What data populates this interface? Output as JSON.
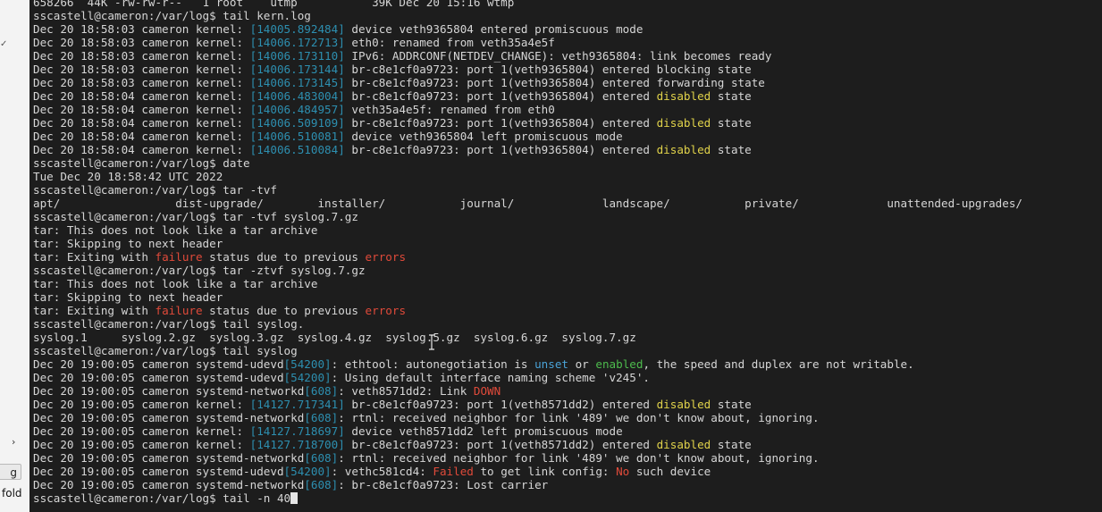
{
  "left_panel": {
    "chevron": "›",
    "button_text": "g",
    "fold_text": "fold"
  },
  "terminal": {
    "lines": [
      [
        {
          "t": "658266  44K -rw-rw-r--   1 root    utmp           39K Dec 20 15:16 wtmp"
        }
      ],
      [
        {
          "t": "sscastell@cameron:/var/log$ tail kern.log"
        }
      ],
      [
        {
          "t": "Dec 20 18:58:03 cameron kernel: "
        },
        {
          "t": "[14005.892484]",
          "c": "ts"
        },
        {
          "t": " device veth9365804 entered promiscuous mode"
        }
      ],
      [
        {
          "t": "Dec 20 18:58:03 cameron kernel: "
        },
        {
          "t": "[14006.172713]",
          "c": "ts"
        },
        {
          "t": " eth0: renamed from veth35a4e5f"
        }
      ],
      [
        {
          "t": "Dec 20 18:58:03 cameron kernel: "
        },
        {
          "t": "[14006.173110]",
          "c": "ts"
        },
        {
          "t": " IPv6: ADDRCONF(NETDEV_CHANGE): veth9365804: link becomes ready"
        }
      ],
      [
        {
          "t": "Dec 20 18:58:03 cameron kernel: "
        },
        {
          "t": "[14006.173144]",
          "c": "ts"
        },
        {
          "t": " br-c8e1cf0a9723: port 1(veth9365804) entered blocking state"
        }
      ],
      [
        {
          "t": "Dec 20 18:58:03 cameron kernel: "
        },
        {
          "t": "[14006.173145]",
          "c": "ts"
        },
        {
          "t": " br-c8e1cf0a9723: port 1(veth9365804) entered forwarding state"
        }
      ],
      [
        {
          "t": "Dec 20 18:58:04 cameron kernel: "
        },
        {
          "t": "[14006.483004]",
          "c": "ts"
        },
        {
          "t": " br-c8e1cf0a9723: port 1(veth9365804) entered "
        },
        {
          "t": "disabled",
          "c": "yl"
        },
        {
          "t": " state"
        }
      ],
      [
        {
          "t": "Dec 20 18:58:04 cameron kernel: "
        },
        {
          "t": "[14006.484957]",
          "c": "ts"
        },
        {
          "t": " veth35a4e5f: renamed from eth0"
        }
      ],
      [
        {
          "t": "Dec 20 18:58:04 cameron kernel: "
        },
        {
          "t": "[14006.509109]",
          "c": "ts"
        },
        {
          "t": " br-c8e1cf0a9723: port 1(veth9365804) entered "
        },
        {
          "t": "disabled",
          "c": "yl"
        },
        {
          "t": " state"
        }
      ],
      [
        {
          "t": "Dec 20 18:58:04 cameron kernel: "
        },
        {
          "t": "[14006.510081]",
          "c": "ts"
        },
        {
          "t": " device veth9365804 left promiscuous mode"
        }
      ],
      [
        {
          "t": "Dec 20 18:58:04 cameron kernel: "
        },
        {
          "t": "[14006.510084]",
          "c": "ts"
        },
        {
          "t": " br-c8e1cf0a9723: port 1(veth9365804) entered "
        },
        {
          "t": "disabled",
          "c": "yl"
        },
        {
          "t": " state"
        }
      ],
      [
        {
          "t": "sscastell@cameron:/var/log$ date"
        }
      ],
      [
        {
          "t": "Tue Dec 20 18:58:42 UTC 2022"
        }
      ],
      [
        {
          "t": "sscastell@cameron:/var/log$ tar -tvf"
        }
      ],
      [
        {
          "t": "apt/                 dist-upgrade/        installer/           journal/             landscape/           private/             unattended-upgrades/"
        }
      ],
      [
        {
          "t": "sscastell@cameron:/var/log$ tar -tvf syslog.7.gz"
        }
      ],
      [
        {
          "t": "tar: This does not look like a tar archive"
        }
      ],
      [
        {
          "t": "tar: Skipping to next header"
        }
      ],
      [
        {
          "t": "tar: Exiting with "
        },
        {
          "t": "failure",
          "c": "rd"
        },
        {
          "t": " status due to previous "
        },
        {
          "t": "errors",
          "c": "rd"
        }
      ],
      [
        {
          "t": "sscastell@cameron:/var/log$ tar -ztvf syslog.7.gz"
        }
      ],
      [
        {
          "t": "tar: This does not look like a tar archive"
        }
      ],
      [
        {
          "t": "tar: Skipping to next header"
        }
      ],
      [
        {
          "t": "tar: Exiting with "
        },
        {
          "t": "failure",
          "c": "rd"
        },
        {
          "t": " status due to previous "
        },
        {
          "t": "errors",
          "c": "rd"
        }
      ],
      [
        {
          "t": "sscastell@cameron:/var/log$ tail syslog."
        }
      ],
      [
        {
          "t": "syslog.1     syslog.2.gz  syslog.3.gz  syslog.4.gz  syslog.5.gz  syslog.6.gz  syslog.7.gz"
        }
      ],
      [
        {
          "t": "sscastell@cameron:/var/log$ tail syslog"
        }
      ],
      [
        {
          "t": "Dec 20 19:00:05 cameron systemd-udevd"
        },
        {
          "t": "[54200]",
          "c": "ts"
        },
        {
          "t": ": ethtool: autonegotiation is "
        },
        {
          "t": "unset",
          "c": "bl"
        },
        {
          "t": " or "
        },
        {
          "t": "enabled",
          "c": "gr"
        },
        {
          "t": ", the speed and duplex are not writable."
        }
      ],
      [
        {
          "t": "Dec 20 19:00:05 cameron systemd-udevd"
        },
        {
          "t": "[54200]",
          "c": "ts"
        },
        {
          "t": ": Using default interface naming scheme 'v245'."
        }
      ],
      [
        {
          "t": "Dec 20 19:00:05 cameron systemd-networkd"
        },
        {
          "t": "[608]",
          "c": "ts"
        },
        {
          "t": ": veth8571dd2: Link "
        },
        {
          "t": "DOWN",
          "c": "rd"
        }
      ],
      [
        {
          "t": "Dec 20 19:00:05 cameron kernel: "
        },
        {
          "t": "[14127.717341]",
          "c": "ts"
        },
        {
          "t": " br-c8e1cf0a9723: port 1(veth8571dd2) entered "
        },
        {
          "t": "disabled",
          "c": "yl"
        },
        {
          "t": " state"
        }
      ],
      [
        {
          "t": "Dec 20 19:00:05 cameron systemd-networkd"
        },
        {
          "t": "[608]",
          "c": "ts"
        },
        {
          "t": ": rtnl: received neighbor for link '489' we don't know about, ignoring."
        }
      ],
      [
        {
          "t": "Dec 20 19:00:05 cameron kernel: "
        },
        {
          "t": "[14127.718697]",
          "c": "ts"
        },
        {
          "t": " device veth8571dd2 left promiscuous mode"
        }
      ],
      [
        {
          "t": "Dec 20 19:00:05 cameron kernel: "
        },
        {
          "t": "[14127.718700]",
          "c": "ts"
        },
        {
          "t": " br-c8e1cf0a9723: port 1(veth8571dd2) entered "
        },
        {
          "t": "disabled",
          "c": "yl"
        },
        {
          "t": " state"
        }
      ],
      [
        {
          "t": "Dec 20 19:00:05 cameron systemd-networkd"
        },
        {
          "t": "[608]",
          "c": "ts"
        },
        {
          "t": ": rtnl: received neighbor for link '489' we don't know about, ignoring."
        }
      ],
      [
        {
          "t": "Dec 20 19:00:05 cameron systemd-udevd"
        },
        {
          "t": "[54200]",
          "c": "ts"
        },
        {
          "t": ": vethc581cd4: "
        },
        {
          "t": "Failed",
          "c": "rd"
        },
        {
          "t": " to get link config: "
        },
        {
          "t": "No",
          "c": "rd"
        },
        {
          "t": " such device"
        }
      ],
      [
        {
          "t": "Dec 20 19:00:05 cameron systemd-networkd"
        },
        {
          "t": "[608]",
          "c": "ts"
        },
        {
          "t": ": br-c8e1cf0a9723: Lost carrier"
        }
      ],
      [
        {
          "t": "sscastell@cameron:/var/log$ tail -n 40"
        }
      ]
    ],
    "colors": {
      "background": "#1d1d1d",
      "text": "#d6d6d6",
      "timestamp": "#2d8fb0",
      "warning": "#e0d24a",
      "error": "#e04a3a",
      "info": "#4aa3d8",
      "ok": "#4dbb4d"
    }
  }
}
